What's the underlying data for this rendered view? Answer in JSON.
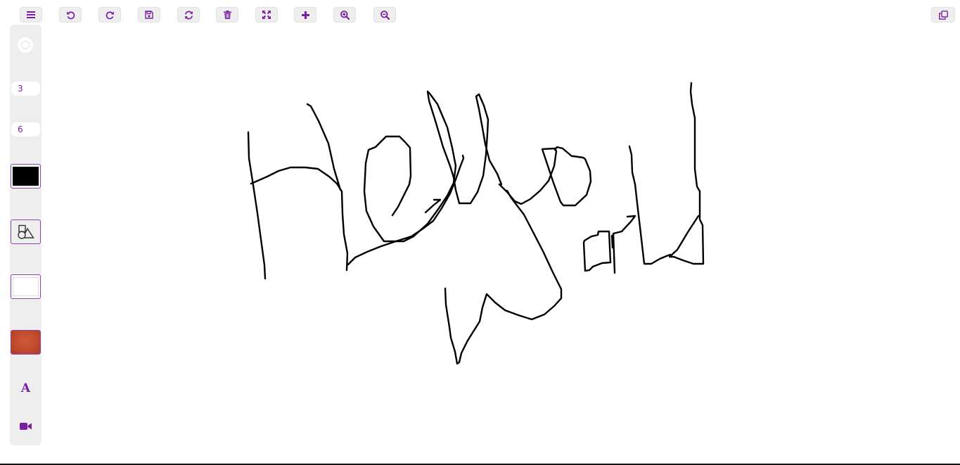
{
  "theme": {
    "accent": "#7b1fa2",
    "panel_bg": "#eeeeee",
    "ink": "#000000"
  },
  "toolbar": {
    "buttons": [
      {
        "name": "menu-button",
        "icon": "menu-icon"
      },
      {
        "name": "undo-button",
        "icon": "undo-icon"
      },
      {
        "name": "redo-button",
        "icon": "redo-icon"
      },
      {
        "name": "save-button",
        "icon": "save-icon"
      },
      {
        "name": "refresh-button",
        "icon": "refresh-icon"
      },
      {
        "name": "delete-button",
        "icon": "trash-icon"
      },
      {
        "name": "fullscreen-button",
        "icon": "expand-icon"
      },
      {
        "name": "add-button",
        "icon": "plus-icon"
      },
      {
        "name": "zoom-in-button",
        "icon": "zoom-in-icon"
      },
      {
        "name": "zoom-out-button",
        "icon": "zoom-out-icon"
      },
      {
        "name": "copy-button",
        "icon": "copy-icon"
      }
    ]
  },
  "sidebar": {
    "stroke_width": "3",
    "second_value": "6",
    "stroke_color": "#000000",
    "fill_color": "#ffffff",
    "background_color": "#c0492b",
    "tools": [
      {
        "name": "shapes-tool",
        "icon": "shapes-icon"
      },
      {
        "name": "text-tool",
        "icon": "text-icon",
        "label": "A"
      },
      {
        "name": "video-tool",
        "icon": "video-camera-icon"
      }
    ]
  }
}
